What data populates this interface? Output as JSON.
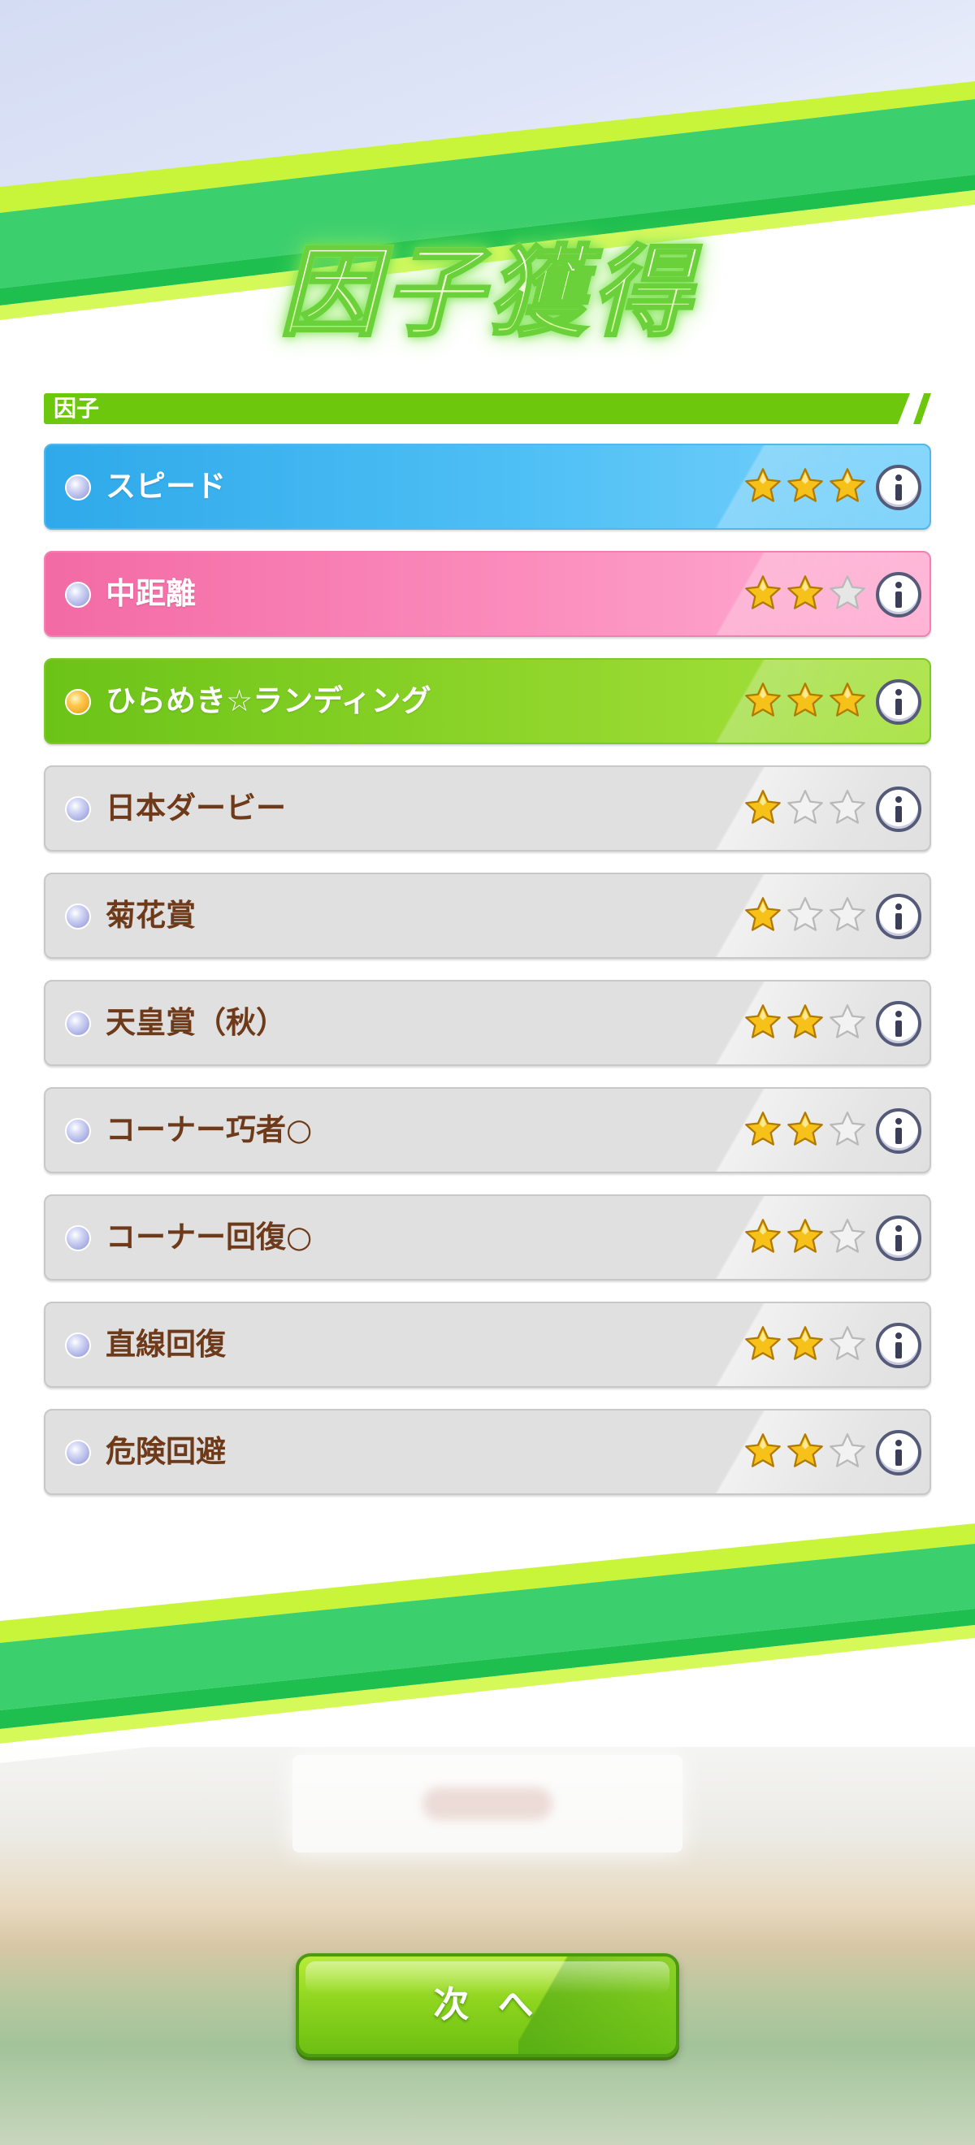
{
  "title": "因子獲得",
  "section": {
    "label": "因子"
  },
  "factors": [
    {
      "label": "スピード",
      "rating": 3,
      "max_rating": 3,
      "style": "blue",
      "dot": "blue-orb"
    },
    {
      "label": "中距離",
      "rating": 2,
      "max_rating": 3,
      "style": "pink",
      "dot": "blue-orb"
    },
    {
      "label": "ひらめき☆ランディング",
      "rating": 3,
      "max_rating": 3,
      "style": "green",
      "dot": "gold-orb"
    },
    {
      "label": "日本ダービー",
      "rating": 1,
      "max_rating": 3,
      "style": "gray",
      "dot": "blue-orb"
    },
    {
      "label": "菊花賞",
      "rating": 1,
      "max_rating": 3,
      "style": "gray",
      "dot": "blue-orb"
    },
    {
      "label": "天皇賞（秋）",
      "rating": 2,
      "max_rating": 3,
      "style": "gray",
      "dot": "blue-orb"
    },
    {
      "label": "コーナー巧者○",
      "rating": 2,
      "max_rating": 3,
      "style": "gray",
      "dot": "blue-orb"
    },
    {
      "label": "コーナー回復○",
      "rating": 2,
      "max_rating": 3,
      "style": "gray",
      "dot": "blue-orb"
    },
    {
      "label": "直線回復",
      "rating": 2,
      "max_rating": 3,
      "style": "gray",
      "dot": "blue-orb"
    },
    {
      "label": "危険回避",
      "rating": 2,
      "max_rating": 3,
      "style": "gray",
      "dot": "blue-orb"
    }
  ],
  "icons": {
    "info": "info-icon",
    "star_filled": "star-filled-icon",
    "star_empty": "star-empty-icon"
  },
  "colors": {
    "speed": "#2fa9ea",
    "distance": "#f36aa4",
    "unique_skill": "#6cc318",
    "gray_row": "#e0e0e0",
    "row_text_dark": "#6e3a1a",
    "accent_green": "#6cc70d",
    "star_gold": "#f6c21a"
  },
  "next_button": {
    "label": "次 へ"
  }
}
